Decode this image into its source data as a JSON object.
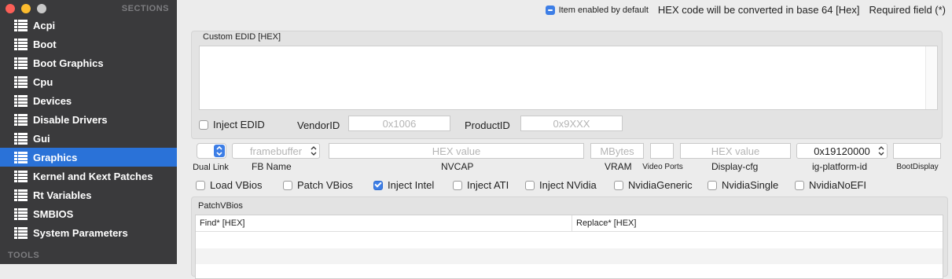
{
  "sidebar": {
    "section_title": "SECTIONS",
    "tools_title": "TOOLS",
    "items": [
      {
        "label": "Acpi"
      },
      {
        "label": "Boot"
      },
      {
        "label": "Boot Graphics"
      },
      {
        "label": "Cpu"
      },
      {
        "label": "Devices"
      },
      {
        "label": "Disable Drivers"
      },
      {
        "label": "Gui"
      },
      {
        "label": "Graphics"
      },
      {
        "label": "Kernel and Kext Patches"
      },
      {
        "label": "Rt Variables"
      },
      {
        "label": "SMBIOS"
      },
      {
        "label": "System Parameters"
      }
    ],
    "selected": "Graphics"
  },
  "topbar": {
    "item_enabled": "Item enabled by default",
    "hex_note": "HEX code will be converted in base 64 [Hex]",
    "required_note": "Required field (*)"
  },
  "edid": {
    "title": "Custom EDID [HEX]",
    "inject_label": "Inject EDID",
    "vendor_label": "VendorID",
    "vendor_placeholder": "0x1006",
    "product_label": "ProductID",
    "product_placeholder": "0x9XXX"
  },
  "graphics_row": {
    "dual_link_label": "Dual Link",
    "fb_name_placeholder": "framebuffer",
    "fb_name_label": "FB Name",
    "nvcap_placeholder": "HEX value",
    "nvcap_label": "NVCAP",
    "vram_placeholder": "MBytes",
    "vram_label": "VRAM",
    "video_ports_label": "Video Ports",
    "display_cfg_placeholder": "HEX value",
    "display_cfg_label": "Display-cfg",
    "ig_platform_value": "0x19120000",
    "ig_platform_label": "ig-platform-id",
    "boot_display_label": "BootDisplay"
  },
  "checkboxes": [
    {
      "label": "Load VBios",
      "checked": false
    },
    {
      "label": "Patch VBios",
      "checked": false
    },
    {
      "label": "Inject Intel",
      "checked": true
    },
    {
      "label": "Inject ATI",
      "checked": false
    },
    {
      "label": "Inject NVidia",
      "checked": false
    },
    {
      "label": "NvidiaGeneric",
      "checked": false
    },
    {
      "label": "NvidiaSingle",
      "checked": false
    },
    {
      "label": "NvidiaNoEFI",
      "checked": false
    }
  ],
  "patch_vbios": {
    "title": "PatchVBios",
    "col_find": "Find* [HEX]",
    "col_replace": "Replace* [HEX]"
  },
  "colors": {
    "accent": "#2a72d8",
    "sidebar_bg": "#3a3a3c",
    "close": "#fc5f57",
    "minimize": "#fdbc2e",
    "zoom": "#c8c8c8"
  }
}
